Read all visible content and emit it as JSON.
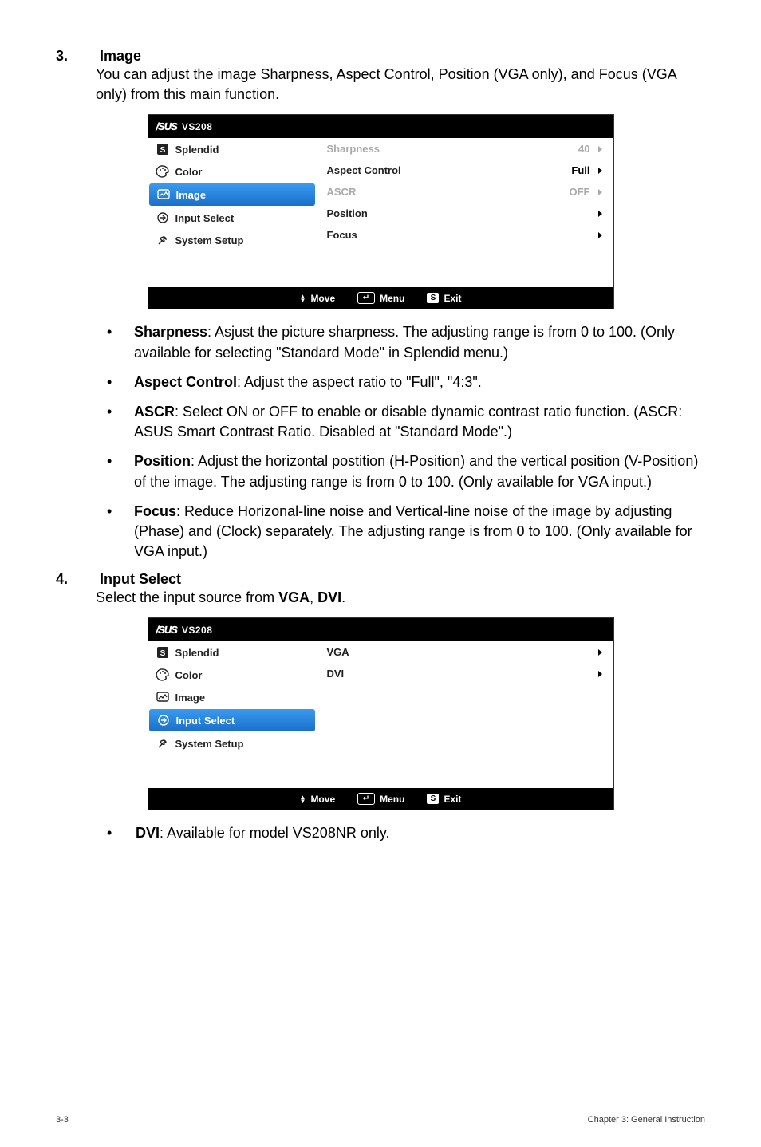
{
  "section3": {
    "num": "3.",
    "title": "Image",
    "intro": "You can adjust the image Sharpness, Aspect Control, Position (VGA only), and Focus (VGA only) from this main function."
  },
  "osd1": {
    "brand": "/SUS",
    "model": "VS208",
    "left": {
      "splendid": "Splendid",
      "color": "Color",
      "image": "Image",
      "input_select": "Input Select",
      "system_setup": "System Setup"
    },
    "right": {
      "sharpness": {
        "label": "Sharpness",
        "value": "40"
      },
      "aspect": {
        "label": "Aspect Control",
        "value": "Full"
      },
      "ascr": {
        "label": "ASCR",
        "value": "OFF"
      },
      "position": {
        "label": "Position"
      },
      "focus": {
        "label": "Focus"
      }
    },
    "footer": {
      "move": "Move",
      "menu": "Menu",
      "exit": "Exit",
      "s": "S"
    }
  },
  "bullets3": {
    "sharpness": {
      "term": "Sharpness",
      "text": ": Asjust the picture sharpness. The adjusting range is from 0 to 100. (Only available for selecting \"Standard Mode\" in Splendid menu.)"
    },
    "aspect": {
      "term": "Aspect Control",
      "text": ": Adjust the aspect ratio to \"Full\", \"4:3\"."
    },
    "ascr": {
      "term": "ASCR",
      "text": ": Select ON or OFF to enable or disable dynamic contrast ratio function. (ASCR: ASUS Smart Contrast Ratio. Disabled at \"Standard Mode\".)"
    },
    "position": {
      "term": "Position",
      "text": ": Adjust the horizontal postition (H-Position) and the vertical position (V-Position) of the image. The adjusting range is from 0 to 100. (Only available for VGA input.)"
    },
    "focus": {
      "term": "Focus",
      "text": ": Reduce Horizonal-line noise and Vertical-line noise of the image by adjusting (Phase) and (Clock) separately. The adjusting range is from 0 to 100. (Only available for VGA input.)"
    }
  },
  "section4": {
    "num": "4.",
    "title": "Input Select",
    "intro_pre": "Select the input source from ",
    "vga": "VGA",
    "comma": ", ",
    "dvi": "DVI",
    "dot": "."
  },
  "osd2": {
    "brand": "/SUS",
    "model": "VS208",
    "left": {
      "splendid": "Splendid",
      "color": "Color",
      "image": "Image",
      "input_select": "Input Select",
      "system_setup": "System Setup"
    },
    "right": {
      "vga": "VGA",
      "dvi": "DVI"
    },
    "footer": {
      "move": "Move",
      "menu": "Menu",
      "exit": "Exit",
      "s": "S"
    }
  },
  "bullet4": {
    "term": "DVI",
    "text": ": Available for model VS208NR only."
  },
  "page_footer": {
    "left": "3-3",
    "right": "Chapter 3: General Instruction"
  }
}
